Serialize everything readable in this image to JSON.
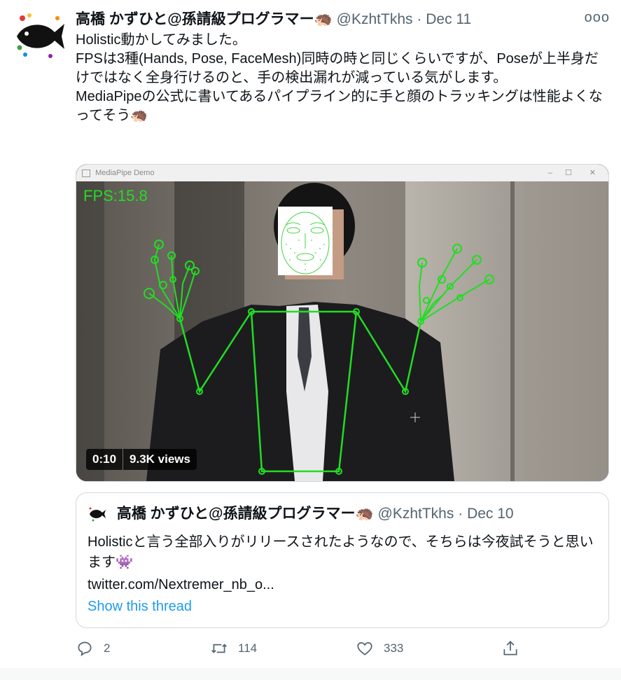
{
  "tweet": {
    "display_name": "高橋 かずひと@孫請級プログラマー🦔",
    "handle": "@KzhtTkhs",
    "separator": "·",
    "date": "Dec 11",
    "more_label": "ooo",
    "text": "Holistic動かしてみました。\nFPSは3種(Hands, Pose, FaceMesh)同時の時と同じくらいですが、Poseが上半身だけではなく全身行けるのと、手の検出漏れが減っている気がします。\nMediaPipeの公式に書いてあるパイプライン的に手と顔のトラッキングは性能よくなってそう🦔"
  },
  "media": {
    "window_title": "MediaPipe Demo",
    "fps_overlay": "FPS:15.8",
    "duration": "0:10",
    "views": "9.3K views"
  },
  "quoted_tweet": {
    "display_name": "高橋 かずひと@孫請級プログラマー🦔",
    "handle": "@KzhtTkhs",
    "separator": "·",
    "date": "Dec 10",
    "text": "Holisticと言う全部入りがリリースされたようなので、そちらは今夜試そうと思います👾",
    "link": "twitter.com/Nextremer_nb_o...",
    "show_thread": "Show this thread"
  },
  "actions": {
    "reply_count": "2",
    "retweet_count": "114",
    "like_count": "333",
    "icons": [
      "reply-icon",
      "retweet-icon",
      "like-icon",
      "share-icon"
    ]
  },
  "colors": {
    "link_blue": "#1d9bf0",
    "muted_gray": "#536471",
    "overlay_green": "#22dd22"
  }
}
